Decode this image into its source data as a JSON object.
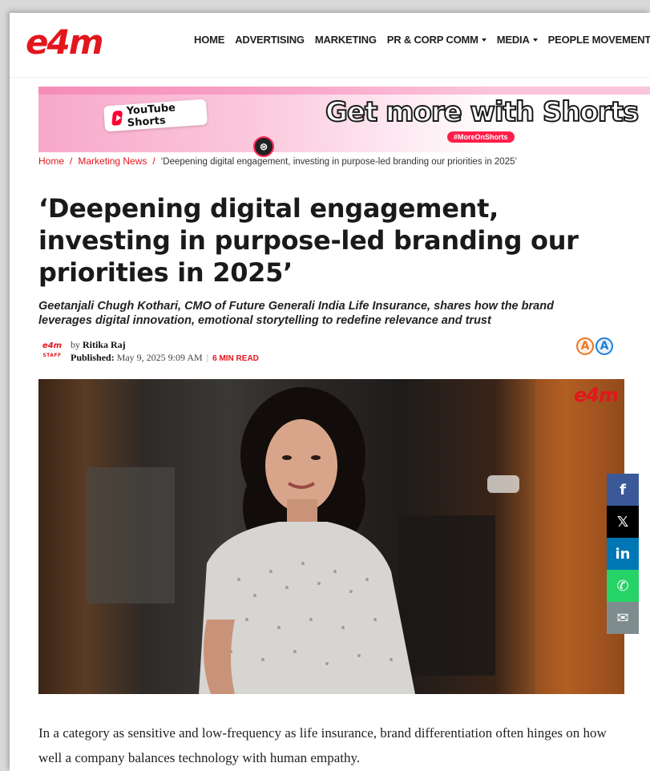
{
  "header": {
    "logo": "e4m",
    "nav": [
      {
        "label": "HOME",
        "dropdown": false
      },
      {
        "label": "ADVERTISING",
        "dropdown": false
      },
      {
        "label": "MARKETING",
        "dropdown": false
      },
      {
        "label": "PR & CORP COMM",
        "dropdown": true
      },
      {
        "label": "MEDIA",
        "dropdown": true
      },
      {
        "label": "PEOPLE MOVEMENT",
        "dropdown": false
      }
    ]
  },
  "banner": {
    "yt_label": "YouTube Shorts",
    "headline": "Get more with Shorts",
    "tag": "#MoreOnShorts"
  },
  "breadcrumb": {
    "home": "Home",
    "section": "Marketing News",
    "current": "‘Deepening digital engagement, investing in purpose-led branding our priorities in 2025’"
  },
  "article": {
    "title": "‘Deepening digital engagement, investing in purpose-led branding our priorities in 2025’",
    "subtitle": "Geetanjali Chugh Kothari, CMO of Future Generali India Life Insurance, shares how the brand leverages digital innovation, emotional storytelling to redefine relevance and trust",
    "byline_logo": "e4m",
    "byline_staff": "STAFF",
    "by_prefix": "by",
    "author": "Ritika Raj",
    "published_label": "Published:",
    "published_date": "May 9, 2025 9:09 AM",
    "read_time": "6 MIN READ",
    "font_small": "A",
    "font_large": "A",
    "image_watermark": "e4m",
    "body_first": "In a category as sensitive and low-frequency as life insurance, brand differentiation often hinges on how well a company balances technology with human empathy."
  },
  "share": {
    "facebook": "f",
    "x": "𝕏",
    "linkedin": "in",
    "whatsapp": "✆",
    "email": "✉"
  },
  "colors": {
    "brand_red": "#e3161d",
    "facebook": "#3b5998",
    "x": "#000000",
    "linkedin": "#0077b5",
    "whatsapp": "#25d366",
    "email": "#7f8c8d"
  }
}
